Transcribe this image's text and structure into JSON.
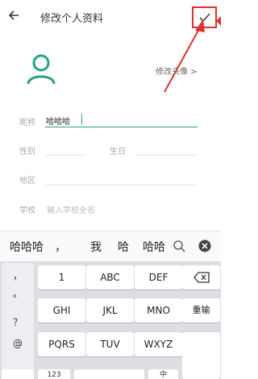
{
  "header": {
    "title": "修改个人资料"
  },
  "profile": {
    "change_avatar": "修改头像 >"
  },
  "form": {
    "nickname_label": "昵称",
    "nickname_value": "哈哈哈",
    "gender_label": "性别",
    "birthday_label": "生日",
    "region_label": "地区",
    "school_label": "学校",
    "school_placeholder": "输入学校全名"
  },
  "candidates": [
    "哈哈哈",
    "，",
    "我",
    "哈",
    "哈哈"
  ],
  "keyboard": {
    "symbols": [
      "，",
      "。",
      "？",
      "@"
    ],
    "rows": [
      [
        "1",
        "ABC",
        "DEF"
      ],
      [
        "GHI",
        "JKL",
        "MNO"
      ],
      [
        "PQRS",
        "TUV",
        "WXYZ"
      ]
    ],
    "reenter": "重输",
    "bottom_left": "123",
    "bottom_cn": "中",
    "delete_icon": "backspace-icon"
  },
  "colors": {
    "accent": "#2aa089",
    "annotation": "#e03030"
  }
}
